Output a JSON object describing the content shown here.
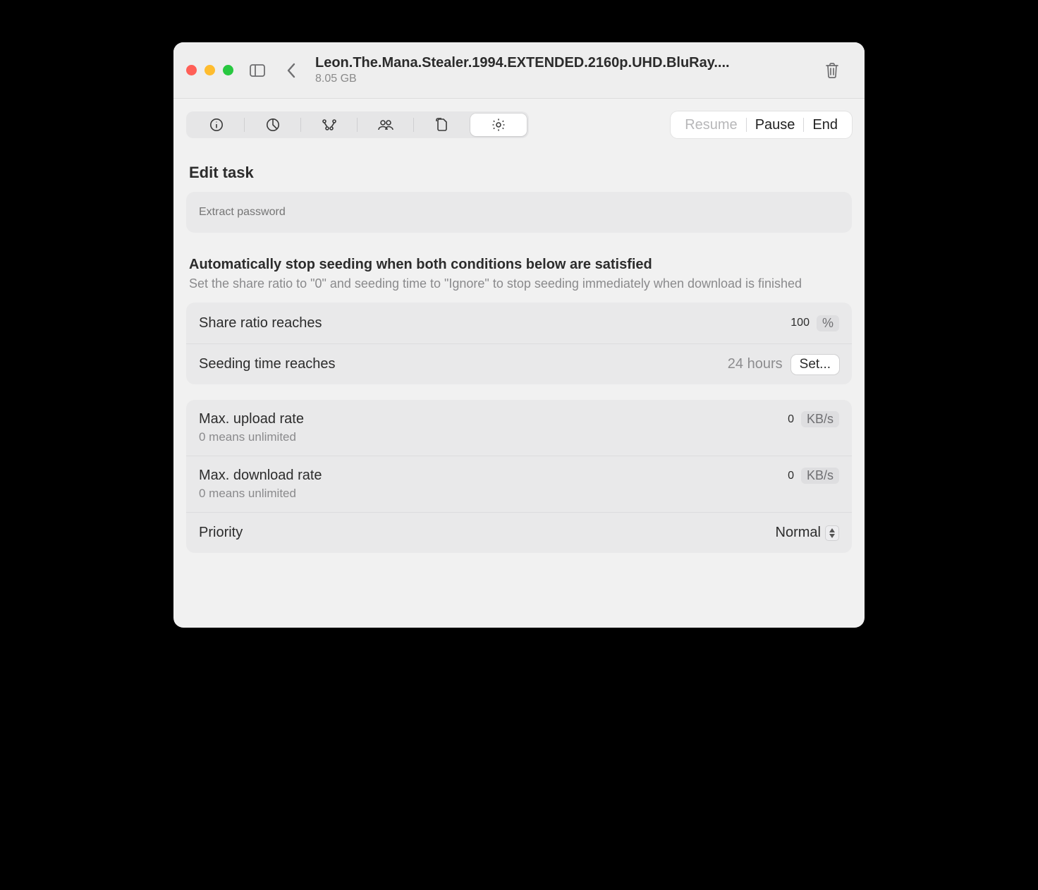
{
  "titlebar": {
    "title": "Leon.The.Mana.Stealer.1994.EXTENDED.2160p.UHD.BluRay....",
    "subtitle": "8.05 GB"
  },
  "actions": {
    "resume": "Resume",
    "pause": "Pause",
    "end": "End"
  },
  "editTask": {
    "title": "Edit task",
    "extractPassword": {
      "placeholder": "Extract password",
      "value": ""
    }
  },
  "seeding": {
    "heading": "Automatically stop seeding when both conditions below are satisfied",
    "sub": "Set the share ratio to \"0\" and seeding time to \"Ignore\" to stop seeding immediately when download is finished",
    "shareRatio": {
      "label": "Share ratio reaches",
      "value": "100",
      "unit": "%"
    },
    "seedingTime": {
      "label": "Seeding time reaches",
      "value": "24 hours",
      "set": "Set..."
    }
  },
  "rates": {
    "upload": {
      "label": "Max. upload rate",
      "hint": "0 means unlimited",
      "value": "0",
      "unit": "KB/s"
    },
    "download": {
      "label": "Max. download rate",
      "hint": "0 means unlimited",
      "value": "0",
      "unit": "KB/s"
    },
    "priority": {
      "label": "Priority",
      "value": "Normal"
    }
  }
}
